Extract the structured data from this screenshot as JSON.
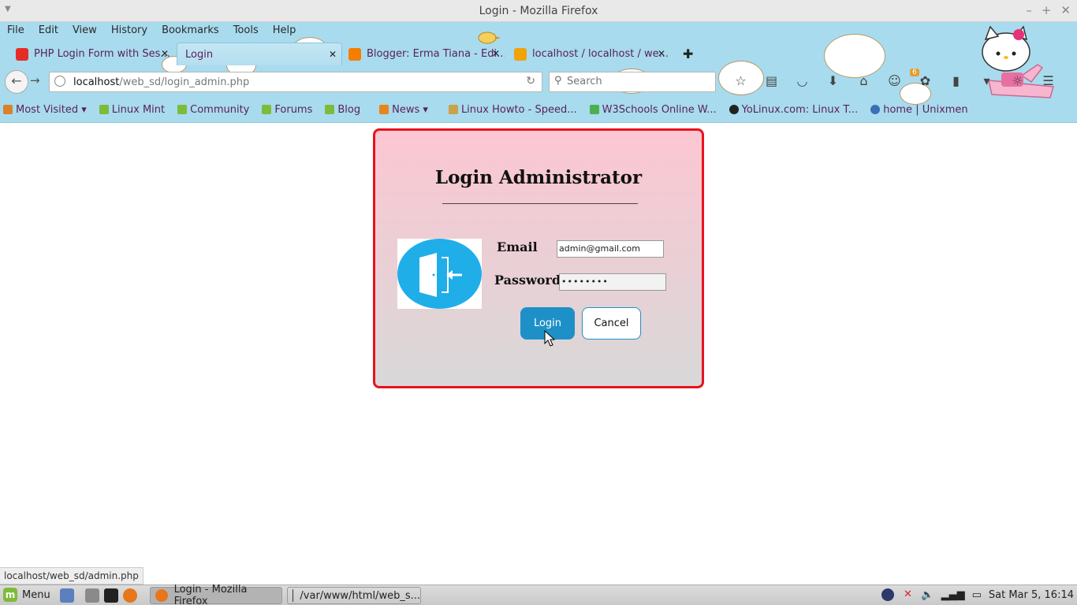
{
  "window": {
    "title": "Login - Mozilla Firefox"
  },
  "menubar": {
    "items": [
      "File",
      "Edit",
      "View",
      "History",
      "Bookmarks",
      "Tools",
      "Help"
    ]
  },
  "tabs": [
    {
      "title": "PHP Login Form with Ses...",
      "icon": "youtube-icon",
      "color": "#e52d27"
    },
    {
      "title": "Login",
      "icon": "none"
    },
    {
      "title": "Blogger: Erma Tiana - Edi...",
      "icon": "blogger-icon",
      "color": "#f57d00"
    },
    {
      "title": "localhost / localhost / we...",
      "icon": "phpmyadmin-icon",
      "color": "#f0a30a"
    }
  ],
  "navbar": {
    "url_host": "localhost",
    "url_path": "/web_sd/login_admin.php",
    "search_placeholder": "Search",
    "notification_count": "6"
  },
  "bookmarks": [
    {
      "label": "Most Visited",
      "dropdown": true,
      "color": "#d9822b"
    },
    {
      "label": "Linux Mint",
      "color": "#7dbb3a"
    },
    {
      "label": "Community",
      "color": "#7dbb3a"
    },
    {
      "label": "Forums",
      "color": "#7dbb3a"
    },
    {
      "label": "Blog",
      "color": "#7dbb3a"
    },
    {
      "label": "News",
      "dropdown": true,
      "color": "#e8841a"
    },
    {
      "label": "Linux Howto - Speed...",
      "color": "#c9a24a"
    },
    {
      "label": "W3Schools Online W...",
      "color": "#4caf50"
    },
    {
      "label": "YoLinux.com: Linux T...",
      "color": "#222222"
    },
    {
      "label": "home | Unixmen",
      "color": "#3b6fb6"
    }
  ],
  "login": {
    "title": "Login Administrator",
    "email_label": "Email",
    "email_value": "admin@gmail.com",
    "password_label": "Password",
    "password_value": "••••••••",
    "login_button": "Login",
    "cancel_button": "Cancel",
    "border_color": "#e8121e",
    "login_button_color": "#1e90c8"
  },
  "statusbar": {
    "text": "localhost/web_sd/admin.php"
  },
  "taskbar": {
    "menu_label": "Menu",
    "tasks": [
      {
        "label": "Login - Mozilla Firefox",
        "active": true
      },
      {
        "label": "/var/www/html/web_s...",
        "active": false
      }
    ],
    "clock": "Sat Mar  5, 16:14"
  }
}
